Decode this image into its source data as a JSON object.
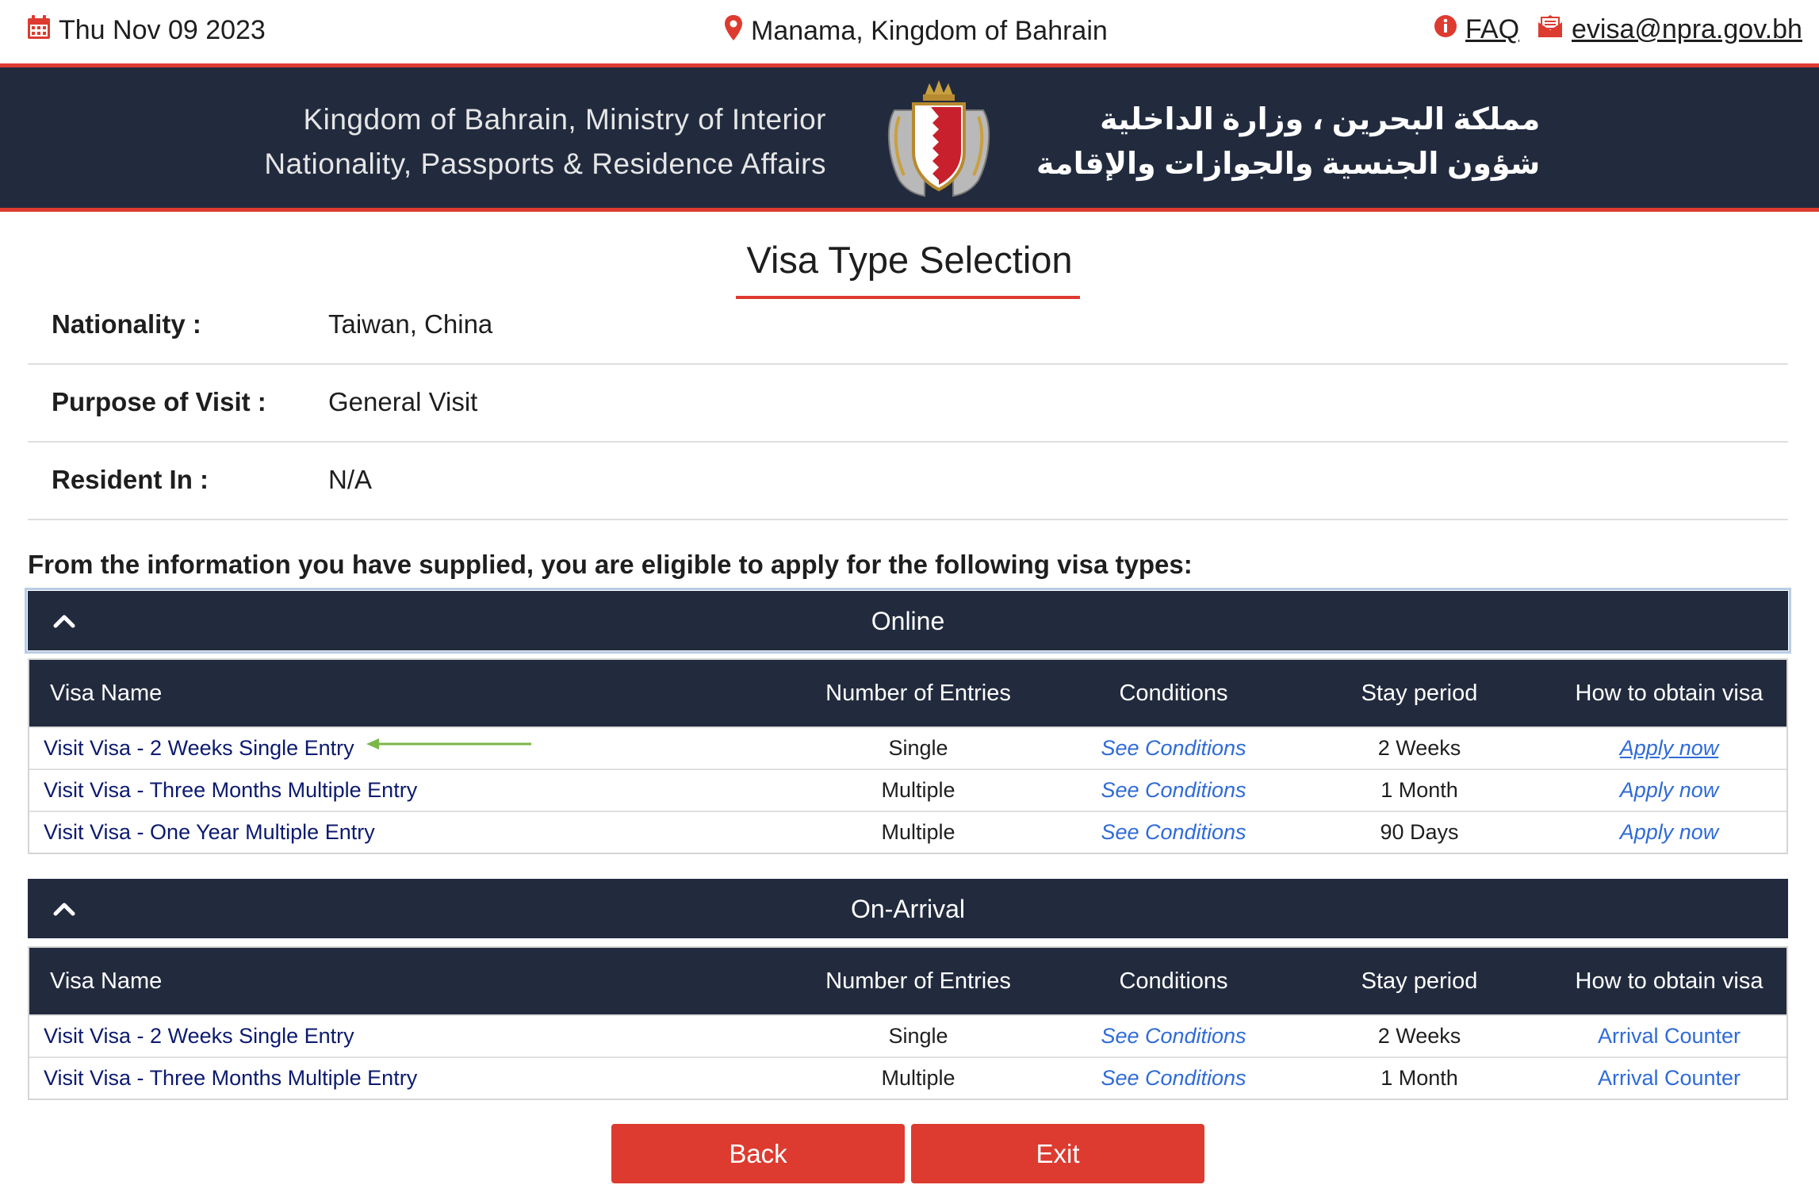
{
  "topbar": {
    "date": "Thu Nov 09 2023",
    "location": "Manama, Kingdom of Bahrain",
    "faq": "FAQ",
    "email": "evisa@npra.gov.bh"
  },
  "banner": {
    "en_line1": "Kingdom of Bahrain, Ministry of Interior",
    "en_line2": "Nationality, Passports & Residence Affairs",
    "ar_line1": "مملكة البحرين ، وزارة الداخلية",
    "ar_line2": "شؤون الجنسية والجوازات والإقامة"
  },
  "page": {
    "title": "Visa Type Selection",
    "eligible_text": "From the information you have supplied, you are eligible to apply for the following visa types:"
  },
  "info": {
    "nationality_label": "Nationality :",
    "nationality_value": "Taiwan, China",
    "purpose_label": "Purpose of Visit :",
    "purpose_value": "General Visit",
    "resident_label": "Resident In :",
    "resident_value": "N/A"
  },
  "columns": {
    "name": "Visa Name",
    "entries": "Number of Entries",
    "conditions": "Conditions",
    "stay": "Stay period",
    "how": "How to obtain visa"
  },
  "online": {
    "title": "Online",
    "rows": [
      {
        "name": "Visit Visa - 2 Weeks Single Entry",
        "entries": "Single",
        "conditions": "See Conditions",
        "stay": "2 Weeks",
        "how": "Apply now"
      },
      {
        "name": "Visit Visa - Three Months Multiple Entry",
        "entries": "Multiple",
        "conditions": "See Conditions",
        "stay": "1 Month",
        "how": "Apply now"
      },
      {
        "name": "Visit Visa - One Year Multiple Entry",
        "entries": "Multiple",
        "conditions": "See Conditions",
        "stay": "90 Days",
        "how": "Apply now"
      }
    ]
  },
  "arrival": {
    "title": "On-Arrival",
    "rows": [
      {
        "name": "Visit Visa - 2 Weeks Single Entry",
        "entries": "Single",
        "conditions": "See Conditions",
        "stay": "2 Weeks",
        "how": "Arrival Counter"
      },
      {
        "name": "Visit Visa - Three Months Multiple Entry",
        "entries": "Multiple",
        "conditions": "See Conditions",
        "stay": "1 Month",
        "how": "Arrival Counter"
      }
    ]
  },
  "buttons": {
    "back": "Back",
    "exit": "Exit"
  },
  "colors": {
    "navy": "#222b3e",
    "accent_red": "#dd3b30",
    "link_blue": "#2f6bd8",
    "visa_name": "#0c1a6e",
    "annotation_arrow": "#7ab648"
  }
}
